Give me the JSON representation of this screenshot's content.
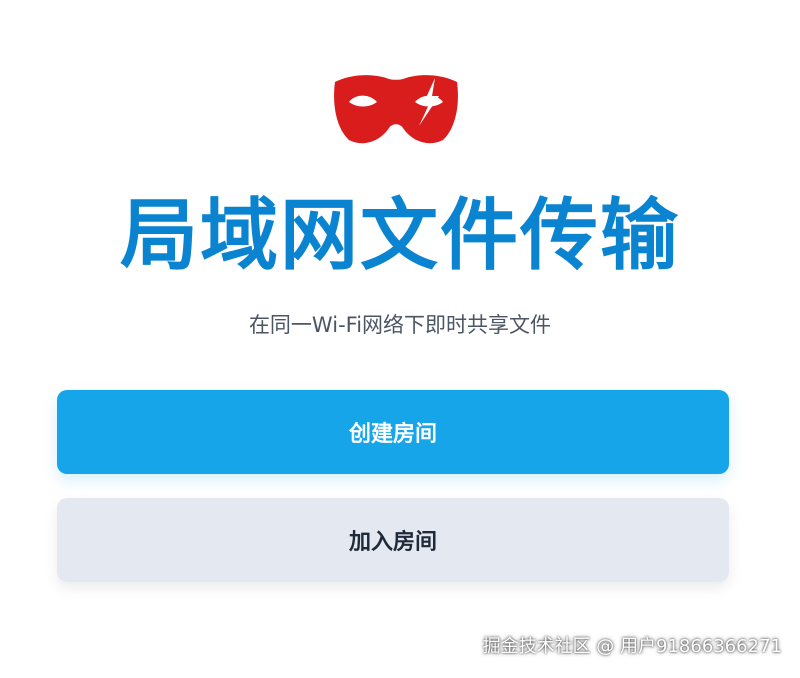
{
  "app": {
    "title": "局域网文件传输",
    "subtitle": "在同一Wi-Fi网络下即时共享文件",
    "logo_icon": "red-mask-icon"
  },
  "actions": {
    "create_room_label": "创建房间",
    "join_room_label": "加入房间"
  },
  "watermark": {
    "text": "掘金技术社区 @ 用户91866366271"
  },
  "colors": {
    "accent": "#17a5ea",
    "title": "#0a84d0",
    "logo": "#d91d1d",
    "secondary_button": "#e4e9f1"
  }
}
